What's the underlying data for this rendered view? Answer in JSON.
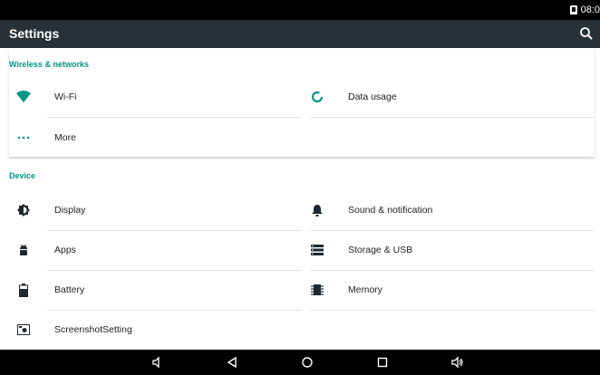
{
  "status_bar": {
    "time": "08:0"
  },
  "toolbar": {
    "title": "Settings"
  },
  "wireless": {
    "header": "Wireless & networks",
    "items": [
      {
        "label": "Wi-Fi",
        "icon": "wifi-icon"
      },
      {
        "label": "Data usage",
        "icon": "data-usage-icon"
      },
      {
        "label": "More",
        "icon": "more-icon"
      }
    ]
  },
  "device": {
    "header": "Device",
    "items": [
      {
        "label": "Display",
        "icon": "brightness-icon"
      },
      {
        "label": "Sound & notification",
        "icon": "bell-icon"
      },
      {
        "label": "Apps",
        "icon": "android-icon"
      },
      {
        "label": "Storage & USB",
        "icon": "storage-icon"
      },
      {
        "label": "Battery",
        "icon": "battery-icon"
      },
      {
        "label": "Memory",
        "icon": "memory-icon"
      },
      {
        "label": "ScreenshotSetting",
        "icon": "screenshot-icon"
      }
    ]
  },
  "colors": {
    "accent": "#009688",
    "toolbar": "#263238",
    "icon": "#1e2a2f"
  }
}
